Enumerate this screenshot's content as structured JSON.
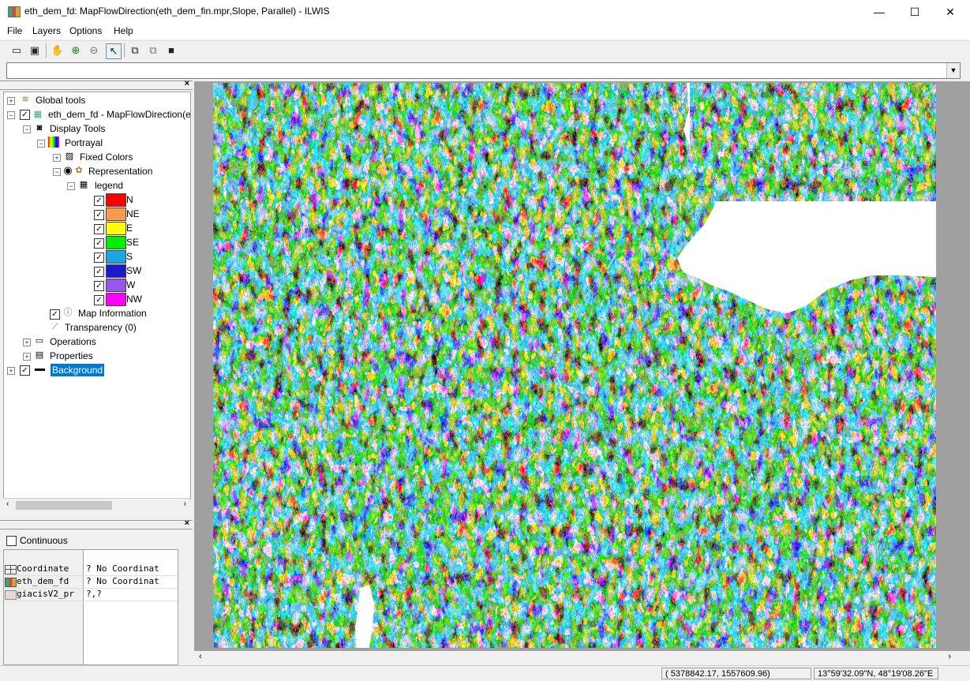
{
  "window": {
    "title": "eth_dem_fd: MapFlowDirection(eth_dem_fin.mpr,Slope, Parallel) - ILWIS",
    "minimize": "—",
    "maximize": "☐",
    "close": "✕"
  },
  "menu": [
    "File",
    "Layers",
    "Options",
    "Help"
  ],
  "toolbar_icons": [
    "new-map-icon",
    "display-icon",
    "pan-icon",
    "zoom-in-icon",
    "zoom-out-icon",
    "select-pointer-icon",
    "copy-icon",
    "paste-icon",
    "save-icon"
  ],
  "combo": {
    "value": ""
  },
  "tree": {
    "global_tools": "Global tools",
    "layer": "eth_dem_fd - MapFlowDirection(e",
    "display_tools": "Display Tools",
    "portrayal": "Portrayal",
    "fixed_colors": "Fixed Colors",
    "representation": "Representation",
    "legend": "legend",
    "legend_items": [
      {
        "label": "N",
        "color": "#ff0000"
      },
      {
        "label": "NE",
        "color": "#ff9a4a"
      },
      {
        "label": "E",
        "color": "#ffff00"
      },
      {
        "label": "SE",
        "color": "#00ee00"
      },
      {
        "label": "S",
        "color": "#1aa6e6"
      },
      {
        "label": "SW",
        "color": "#1a1acc"
      },
      {
        "label": "W",
        "color": "#9955ee"
      },
      {
        "label": "NW",
        "color": "#ff00ff"
      }
    ],
    "map_information": "Map Information",
    "transparency": "Transparency (0)",
    "operations": "Operations",
    "properties": "Properties",
    "background": "Background"
  },
  "pixel_info": {
    "continuous_label": "Continuous",
    "rows": [
      {
        "name": "Coordinate",
        "value": "? No Coordinat"
      },
      {
        "name": "eth_dem_fd",
        "value": "? No Coordinat"
      },
      {
        "name": "giacisV2_pr",
        "value": "?,?"
      }
    ]
  },
  "status": {
    "coordinates": "( 5378842.17,  1557609.96)",
    "latlon": "13°59'32.09\"N, 48°19'08.26\"E"
  }
}
